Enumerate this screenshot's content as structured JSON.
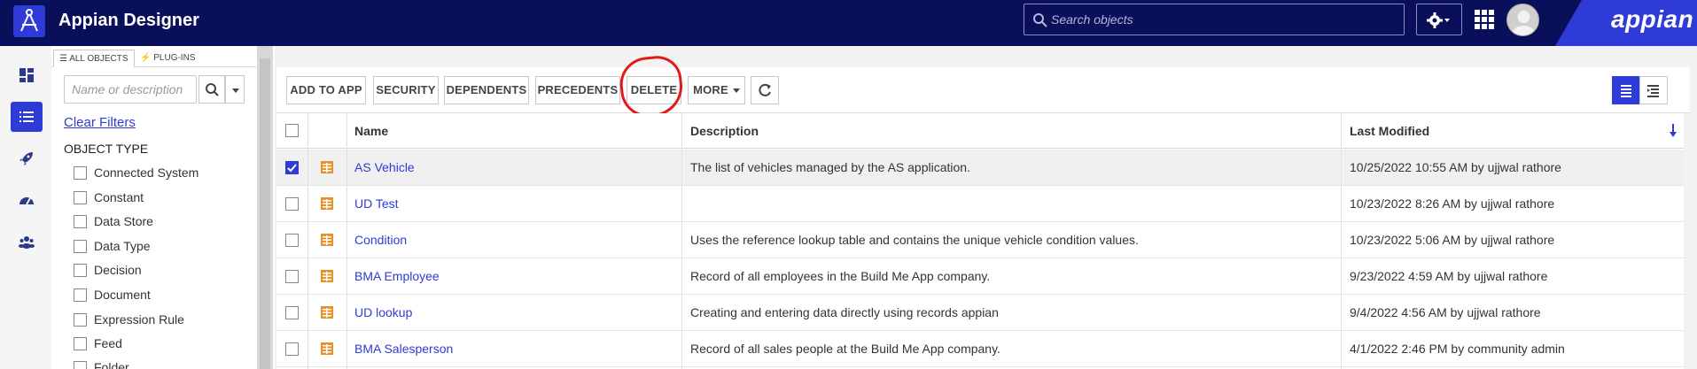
{
  "header": {
    "app_title": "Appian Designer",
    "search_placeholder": "Search objects",
    "brand": "appian"
  },
  "colors": {
    "topbar": "#0a0f59",
    "accent": "#2f3bd6",
    "annotation": "#e01a1a",
    "record_icon": "#e8912c"
  },
  "nav": {
    "items": [
      "dashboard-icon",
      "list-icon",
      "rocket-icon",
      "gauge-icon",
      "users-icon"
    ],
    "active": 1
  },
  "filters": {
    "tabs": [
      "ALL OBJECTS",
      "PLUG-INS"
    ],
    "search_placeholder": "Name or description",
    "clear_label": "Clear Filters",
    "heading": "OBJECT TYPE",
    "options": [
      "Connected System",
      "Constant",
      "Data Store",
      "Data Type",
      "Decision",
      "Document",
      "Expression Rule",
      "Feed",
      "Folder"
    ]
  },
  "toolbar": {
    "add_to_app": "ADD TO APP",
    "security": "SECURITY",
    "dependents": "DEPENDENTS",
    "precedents": "PRECEDENTS",
    "delete": "DELETE",
    "more": "MORE"
  },
  "table": {
    "columns": [
      "Name",
      "Description",
      "Last Modified"
    ],
    "rows": [
      {
        "name": "AS Vehicle",
        "description": "The list of vehicles managed by the AS application.",
        "modified": "10/25/2022 10:55 AM by ujjwal rathore",
        "checked": true
      },
      {
        "name": "UD Test",
        "description": "",
        "modified": "10/23/2022 8:26 AM by ujjwal rathore",
        "checked": false
      },
      {
        "name": "Condition",
        "description": "Uses the reference lookup table and contains the unique vehicle condition values.",
        "modified": "10/23/2022 5:06 AM by ujjwal rathore",
        "checked": false
      },
      {
        "name": "BMA Employee",
        "description": "Record of all employees in the Build Me App company.",
        "modified": "9/23/2022 4:59 AM by ujjwal rathore",
        "checked": false
      },
      {
        "name": "UD lookup",
        "description": "Creating and entering data directly using records appian",
        "modified": "9/4/2022 4:56 AM by ujjwal rathore",
        "checked": false
      },
      {
        "name": "BMA Salesperson",
        "description": "Record of all sales people at the Build Me App company.",
        "modified": "4/1/2022 2:46 PM by community admin",
        "checked": false
      }
    ]
  }
}
